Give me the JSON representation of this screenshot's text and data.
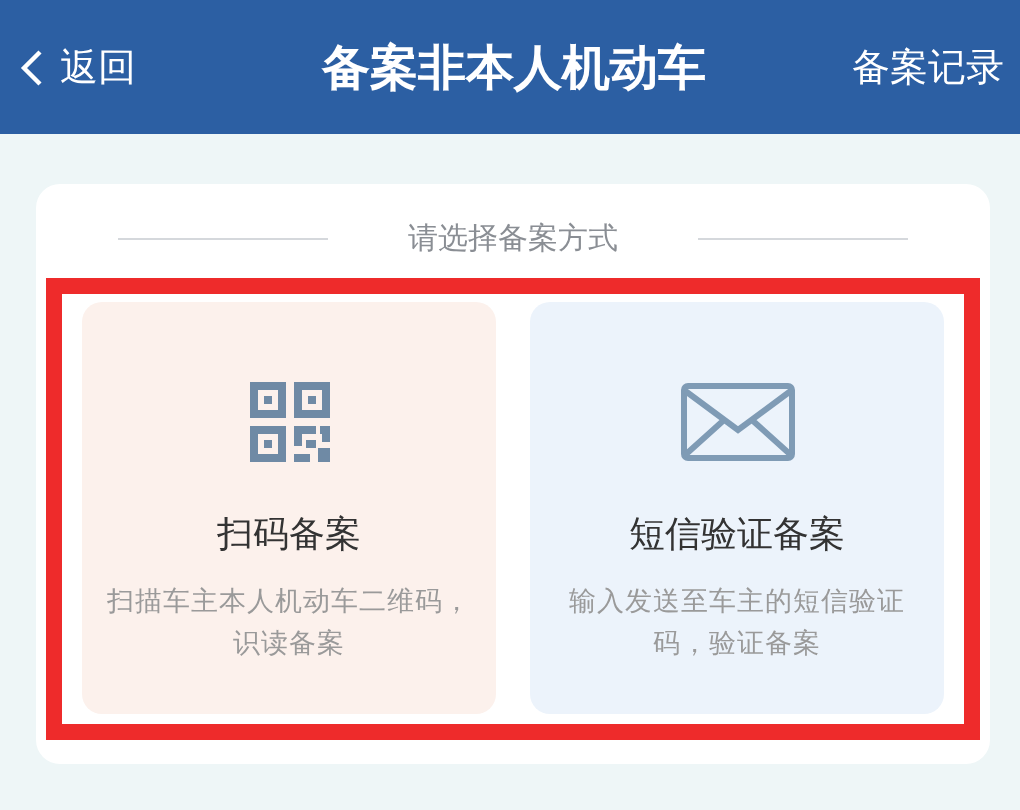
{
  "header": {
    "back": "返回",
    "title": "备案非本人机动车",
    "action": "备案记录"
  },
  "section_title": "请选择备案方式",
  "highlight": true,
  "options": [
    {
      "kind": "qr",
      "title": "扫码备案",
      "description": "扫描车主本人机动车二维码，识读备案"
    },
    {
      "kind": "sms",
      "title": "短信验证备案",
      "description": "输入发送至车主的短信验证码，验证备案"
    }
  ]
}
